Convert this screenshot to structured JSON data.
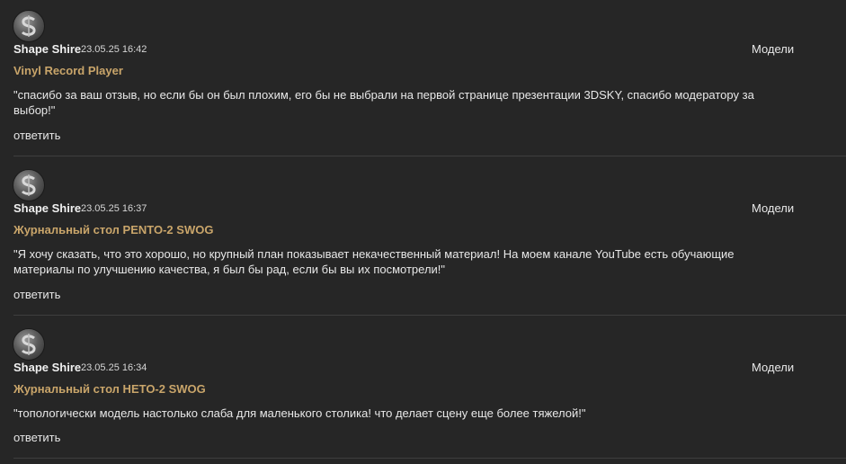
{
  "comments": [
    {
      "author": "Shape Shire",
      "date": "23.05.25 16:42",
      "category": "Модели",
      "model": "Vinyl Record Player",
      "text": "\"спасибо за ваш отзыв, но если бы он был плохим, его бы не выбрали на первой странице презентации 3DSKY, спасибо модератору за выбор!\"",
      "reply_label": "ответить"
    },
    {
      "author": "Shape Shire",
      "date": "23.05.25 16:37",
      "category": "Модели",
      "model": "Журнальный стол PENTO-2 SWOG",
      "text": "\"Я хочу сказать, что это хорошо, но крупный план показывает некачественный материал! На моем канале YouTube есть обучающие материалы по улучшению качества, я был бы рад, если бы вы их посмотрели!\"",
      "reply_label": "ответить"
    },
    {
      "author": "Shape Shire",
      "date": "23.05.25 16:34",
      "category": "Модели",
      "model": "Журнальный стол HETO-2 SWOG",
      "text": "\"топологически модель настолько слаба для маленького столика! что делает сцену еще более тяжелой!\"",
      "reply_label": "ответить"
    }
  ]
}
